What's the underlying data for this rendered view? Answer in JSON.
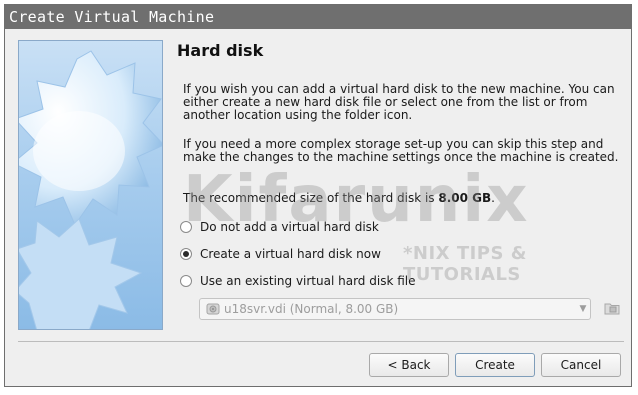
{
  "window": {
    "title": "Create Virtual Machine"
  },
  "page": {
    "title": "Hard disk",
    "paragraph1": "If you wish you can add a virtual hard disk to the new machine. You can either create a new hard disk file or select one from the list or from another location using the folder icon.",
    "paragraph2": "If you need a more complex storage set-up you can skip this step and make the changes to the machine settings once the machine is created.",
    "recommended_prefix": "The recommended size of the hard disk is ",
    "recommended_size": "8.00 GB",
    "recommended_suffix": "."
  },
  "options": [
    {
      "label": "Do not add a virtual hard disk",
      "checked": false
    },
    {
      "label": "Create a virtual hard disk now",
      "checked": true
    },
    {
      "label": "Use an existing virtual hard disk file",
      "checked": false
    }
  ],
  "disk_select": {
    "value": "u18svr.vdi (Normal, 8.00 GB)",
    "enabled": false
  },
  "buttons": {
    "back": "< Back",
    "create": "Create",
    "cancel": "Cancel"
  },
  "watermark": {
    "brand": "Kifarunix",
    "tagline": "*NIX TIPS & TUTORIALS"
  },
  "icons": {
    "disk": "hard-disk-icon",
    "folder": "folder-icon",
    "dropdown": "chevron-down-icon",
    "wizard": "virtualbox-wizard-illustration"
  }
}
